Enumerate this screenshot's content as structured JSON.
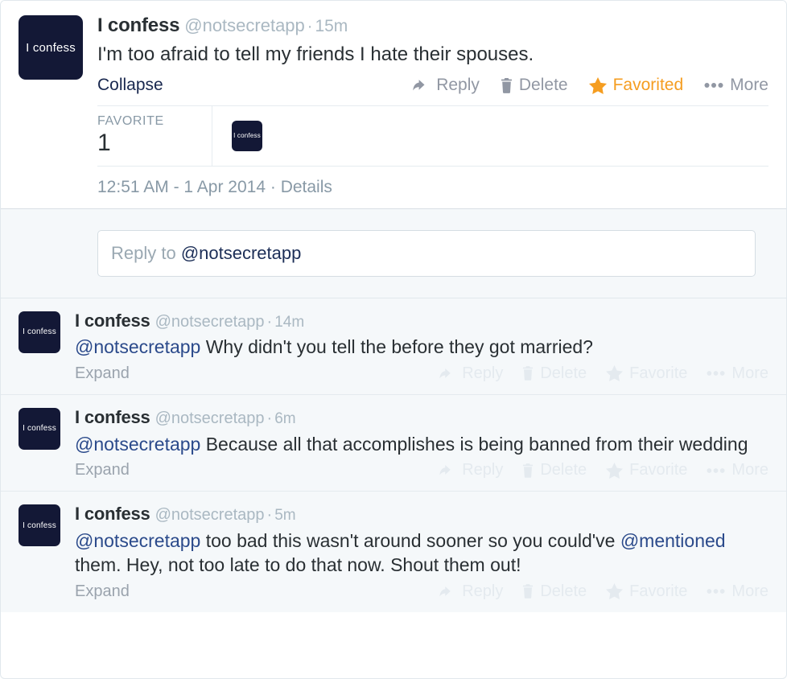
{
  "colors": {
    "avatar_bg": "#131836",
    "link_blue": "#2b4a8b",
    "favorited_orange": "#f59d20",
    "muted_gray": "#aab8c2",
    "reply_bg": "#f5f8fa"
  },
  "main_tweet": {
    "avatar_text": "I confess",
    "fullname": "I confess",
    "username": "@notsecretapp",
    "separator": "·",
    "timestamp": "15m",
    "text": "I'm too afraid to tell my friends I hate their spouses.",
    "collapse_label": "Collapse",
    "actions": [
      {
        "name": "reply",
        "label": "Reply",
        "icon": "reply-arrow-icon",
        "active": false
      },
      {
        "name": "delete",
        "label": "Delete",
        "icon": "trash-icon",
        "active": false
      },
      {
        "name": "favorite",
        "label": "Favorited",
        "icon": "star-icon",
        "active": true
      },
      {
        "name": "more",
        "label": "More",
        "icon": "ellipsis-icon",
        "active": false
      }
    ],
    "stats": {
      "label": "FAVORITE",
      "value": "1",
      "faces": [
        {
          "avatar_text": "I confess"
        }
      ]
    },
    "detail": {
      "time": "12:51 AM",
      "dash": "-",
      "date": "1 Apr 2014",
      "separator": "·",
      "details_label": "Details"
    }
  },
  "composer": {
    "prefix": "Reply to ",
    "handle": "@notsecretapp",
    "placeholder": "Reply to @notsecretapp"
  },
  "reply_actions": [
    {
      "name": "reply",
      "label": "Reply",
      "icon": "reply-arrow-icon"
    },
    {
      "name": "delete",
      "label": "Delete",
      "icon": "trash-icon"
    },
    {
      "name": "favorite",
      "label": "Favorite",
      "icon": "star-icon"
    },
    {
      "name": "more",
      "label": "More",
      "icon": "ellipsis-icon"
    }
  ],
  "replies": [
    {
      "avatar_text": "I confess",
      "fullname": "I confess",
      "username": "@notsecretapp",
      "separator": "·",
      "timestamp": "14m",
      "mention": "@notsecretapp",
      "text": " Why didn't you tell the before they got married?",
      "expand_label": "Expand"
    },
    {
      "avatar_text": "I confess",
      "fullname": "I confess",
      "username": "@notsecretapp",
      "separator": "·",
      "timestamp": "6m",
      "mention": "@notsecretapp",
      "text": " Because all that accomplishes is being banned from their wedding",
      "expand_label": "Expand"
    },
    {
      "avatar_text": "I confess",
      "fullname": "I confess",
      "username": "@notsecretapp",
      "separator": "·",
      "timestamp": "5m",
      "mention": "@notsecretapp",
      "text": " too bad this wasn't around sooner so you could've ",
      "mention2": "@mentioned",
      "text2": " them. Hey, not too late to do that now. Shout them out!",
      "expand_label": "Expand"
    }
  ]
}
